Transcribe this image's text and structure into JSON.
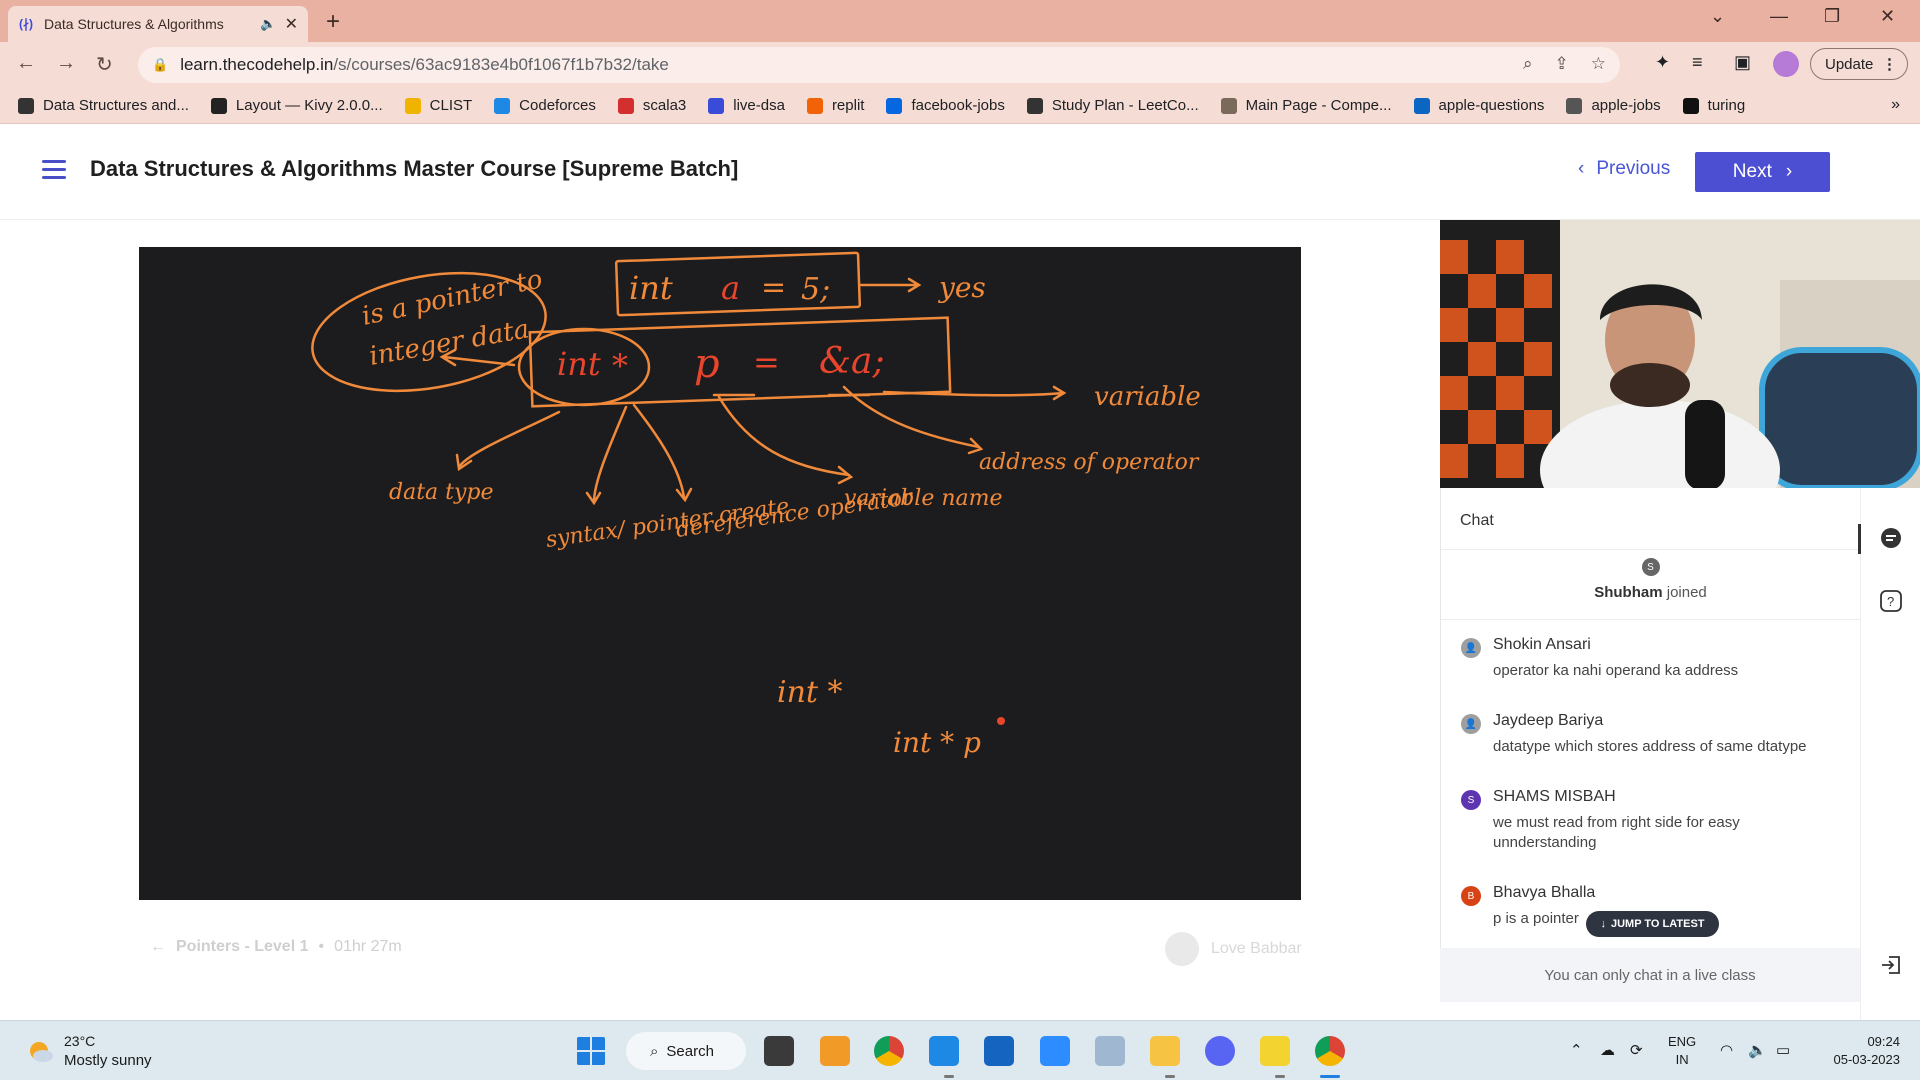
{
  "browser": {
    "tab_title": "Data Structures & Algorithms",
    "url_domain": "learn.thecodehelp.in",
    "url_path": "/s/courses/63ac9183e4b0f1067f1b7b32/take",
    "update_label": "Update",
    "bookmarks": [
      {
        "label": "Data Structures and...",
        "color": "#333333"
      },
      {
        "label": "Layout — Kivy 2.0.0...",
        "color": "#222222"
      },
      {
        "label": "CLIST",
        "color": "#f0b400"
      },
      {
        "label": "Codeforces",
        "color": "#1e88e5"
      },
      {
        "label": "scala3",
        "color": "#d32f2f"
      },
      {
        "label": "live-dsa",
        "color": "#3a4bd8"
      },
      {
        "label": "replit",
        "color": "#f26207"
      },
      {
        "label": "facebook-jobs",
        "color": "#0668e1"
      },
      {
        "label": "Study Plan - LeetCo...",
        "color": "#333333"
      },
      {
        "label": "Main Page - Compe...",
        "color": "#7a6a5a"
      },
      {
        "label": "apple-questions",
        "color": "#0a66c2"
      },
      {
        "label": "apple-jobs",
        "color": "#555555"
      },
      {
        "label": "turing",
        "color": "#111111"
      }
    ]
  },
  "header": {
    "course_title": "Data Structures & Algorithms Master Course [Supreme Batch]",
    "previous_label": "Previous",
    "next_label": "Next"
  },
  "lesson": {
    "name": "Pointers - Level 1",
    "duration": "01hr 27m",
    "instructor": "Love Babbar"
  },
  "whiteboard": {
    "texts": [
      "is a pointer to",
      "integer data",
      "int",
      "a",
      "=",
      "5;",
      "yes",
      "int",
      "*",
      "p",
      "=",
      "&a;",
      "variable",
      "data type",
      "syntax/ pointer create",
      "dereference operator",
      "variable name",
      "address of operator",
      "int *",
      "int * p"
    ]
  },
  "chat": {
    "title": "Chat",
    "joined_user": "Shubham",
    "joined_suffix": "joined",
    "joined_initial": "S",
    "messages": [
      {
        "initial": "",
        "sender": "Shokin Ansari",
        "text": "operator ka nahi operand ka address",
        "color": "#9e9e9e"
      },
      {
        "initial": "",
        "sender": "Jaydeep Bariya",
        "text": "datatype which stores address of same dtatype",
        "color": "#9e9e9e"
      },
      {
        "initial": "S",
        "sender": "SHAMS MISBAH",
        "text": "we must read from right side for easy unnderstanding",
        "color": "#5e35b1"
      },
      {
        "initial": "B",
        "sender": "Bhavya Bhalla",
        "text": "p is a pointer",
        "color": "#d84315"
      }
    ],
    "jump_label": "JUMP TO LATEST",
    "footer": "You can only chat in a live class"
  },
  "taskbar": {
    "temperature": "23°C",
    "weather": "Mostly sunny",
    "search_label": "Search",
    "lang_line1": "ENG",
    "lang_line2": "IN",
    "time": "09:24",
    "date": "05-03-2023"
  },
  "colors": {
    "accent": "#4c4fd1",
    "chalk": "#f08a3a",
    "chalk_red": "#e8452c",
    "chrome": "#e8b1a2"
  }
}
